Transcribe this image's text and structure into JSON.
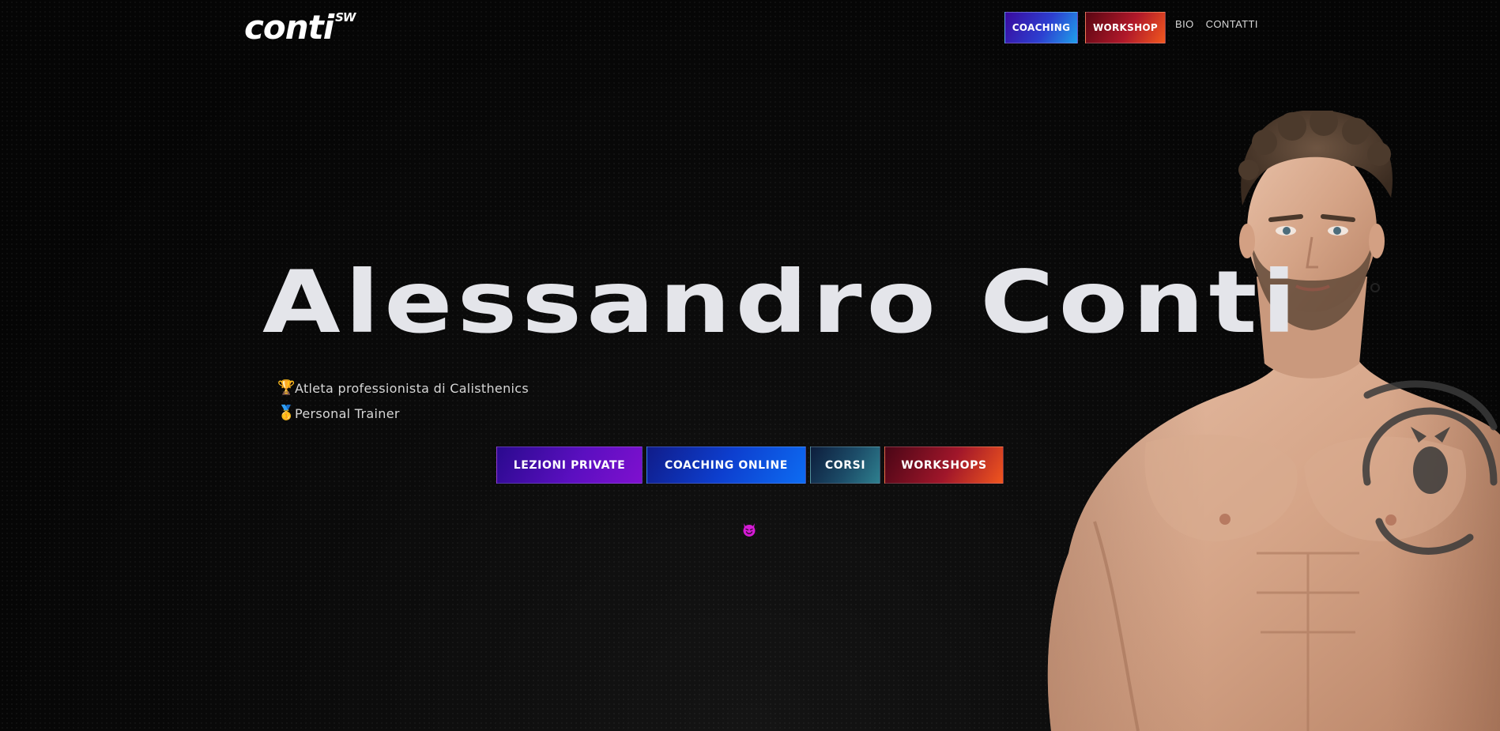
{
  "header": {
    "logo_main": "conti",
    "logo_sup": "SW",
    "nav": {
      "coaching_label": "COACHING",
      "workshop_label": "WORKSHOP",
      "bio_label": "BIO",
      "contatti_label": "CONTATTI"
    }
  },
  "hero": {
    "title": "Alessandro Conti",
    "bullets": [
      {
        "icon": "trophy-icon",
        "emoji": "🏆",
        "text": "Atleta professionista di Calisthenics"
      },
      {
        "icon": "medal-icon",
        "emoji": "🥇",
        "text": "Personal Trainer"
      }
    ],
    "cta": {
      "lezioni_label": "LEZIONI PRIVATE",
      "coaching_label": "COACHING ONLINE",
      "corsi_label": "CORSI",
      "workshops_label": "WORKSHOPS"
    },
    "scroll_icon": "devil-icon"
  },
  "colors": {
    "background": "#050505",
    "title": "#e4e5ea",
    "coaching_gradient": [
      "#3a0a9e",
      "#1fa0ea"
    ],
    "workshop_gradient": [
      "#5a0612",
      "#f2581e"
    ],
    "lezioni_gradient": [
      "#2a0a8e",
      "#7f10cf"
    ],
    "coaching_online_gradient": [
      "#101c8a",
      "#0d6cf2"
    ],
    "corsi_gradient": [
      "#0d1d3c",
      "#2e7f8e"
    ],
    "accent_magenta": "#d41bd4"
  }
}
